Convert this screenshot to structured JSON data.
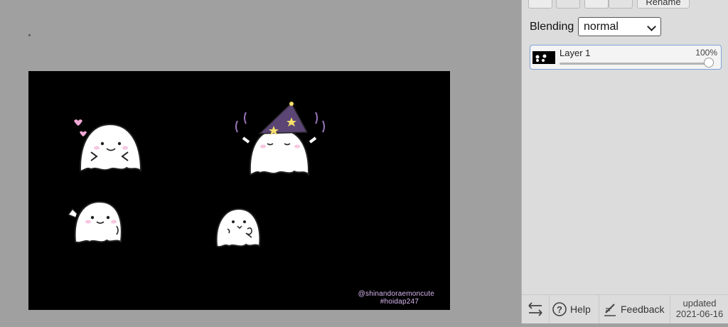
{
  "canvas": {
    "credit_line1": "@shinandoraemoncute",
    "credit_line2": "#hoidap247"
  },
  "toolbar": {
    "buttons": [
      "add-layer-icon",
      "delete-layer-icon",
      "duplicate-layer-icon",
      "merge-layer-icon"
    ],
    "rename_label": "Rename"
  },
  "blending": {
    "label": "Blending",
    "value": "normal"
  },
  "layers": [
    {
      "name": "Layer 1",
      "opacity": "100%",
      "opacity_value": 100
    }
  ],
  "footer": {
    "swap_icon": "swap-arrows-icon",
    "help_label": "Help",
    "feedback_label": "Feedback",
    "updated_line1": "updated",
    "updated_line2": "2021-06-16"
  },
  "colors": {
    "accent_border": "#7da2d8",
    "canvas_bg": "#000000",
    "credit_text": "#d9b8f2"
  }
}
